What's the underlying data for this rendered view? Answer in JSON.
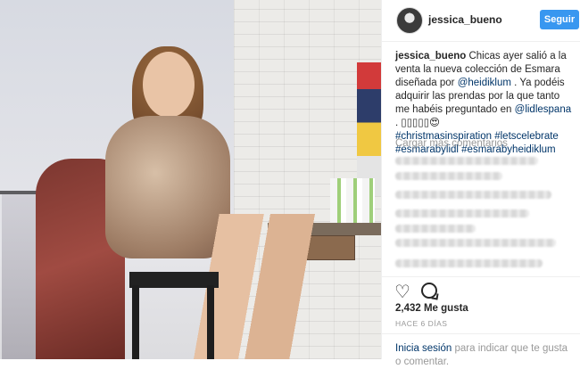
{
  "post": {
    "username": "jessica_bueno",
    "follow_label": "Seguir",
    "caption": {
      "username": "jessica_bueno",
      "part1": " Chicas ayer salió a la venta la nueva colección de Esmara diseñada por ",
      "mention1": "@heidiklum",
      "part2": " . Ya podéis adquirir las prendas por la que tanto me habéis preguntado en ",
      "mention2": "@lidlespana",
      "part3": " . ▯▯▯▯▯😍",
      "hashtag1": "#christmasinspiration",
      "hashtag2": "#letscelebrate",
      "hashtag3": "#esmarabylidl",
      "hashtag4": "#esmarabyheidiklum"
    },
    "load_more": "Cargar más comentarios",
    "likes": "2,432 Me gusta",
    "time": "HACE 6 DÍAS",
    "login_link": "Inicia sesión",
    "login_rest": " para indicar que te gusta o comentar."
  },
  "icons": {
    "heart": "heart-icon",
    "comment": "comment-icon"
  },
  "colors": {
    "accent": "#3897f0",
    "link": "#003569",
    "muted": "#999999"
  }
}
